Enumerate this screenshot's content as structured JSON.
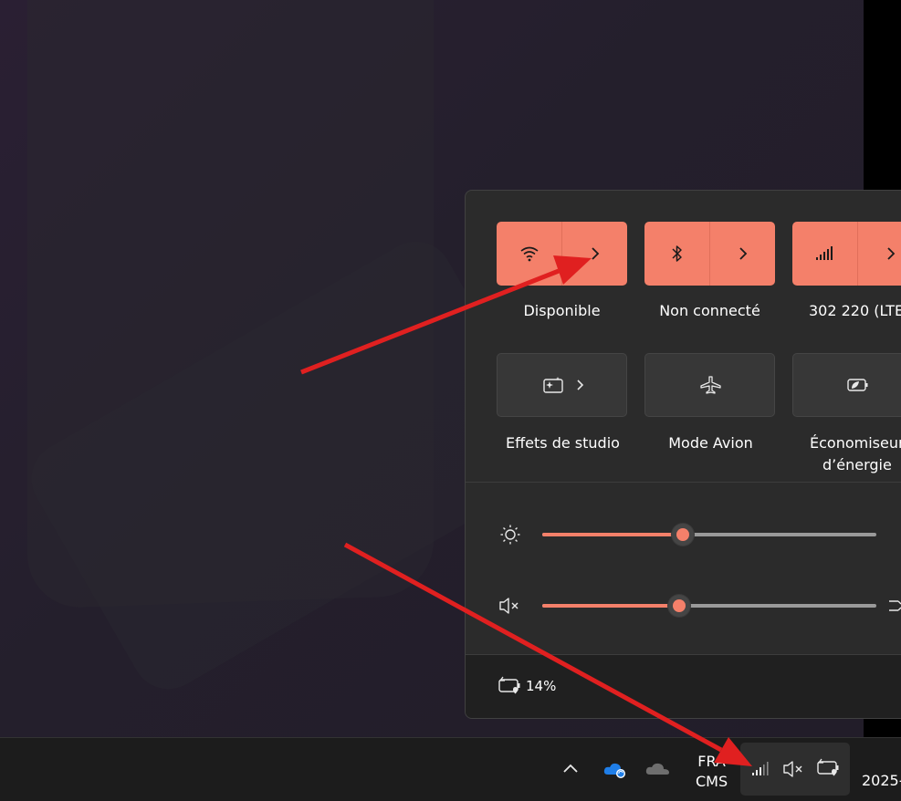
{
  "quick_settings": {
    "tiles_row1": [
      {
        "label": "Disponible",
        "icon": "wifi-icon",
        "state": "on"
      },
      {
        "label": "Non connecté",
        "icon": "bluetooth-icon",
        "state": "on"
      },
      {
        "label": "302 220 (LTE",
        "icon": "cellular-icon",
        "state": "on"
      }
    ],
    "tiles_row2": [
      {
        "label": "Effets de studio",
        "icon": "studio-effects-icon",
        "state": "off"
      },
      {
        "label": "Mode Avion",
        "icon": "airplane-icon",
        "state": "off"
      },
      {
        "label_line1": "Économiseur",
        "label_line2": "d’énergie",
        "icon": "battery-saver-icon",
        "state": "off"
      }
    ],
    "brightness": {
      "value": 0.42,
      "icon": "brightness-icon"
    },
    "volume": {
      "value": 0.41,
      "icon": "volume-muted-icon"
    },
    "battery": {
      "percent": "14%",
      "icon": "battery-charging-icon"
    }
  },
  "taskbar": {
    "lang_line1": "FRA",
    "lang_line2": "CMS",
    "clock_partial": "2025-"
  },
  "colors": {
    "accent": "#f4806a",
    "arrow": "#e02020"
  }
}
